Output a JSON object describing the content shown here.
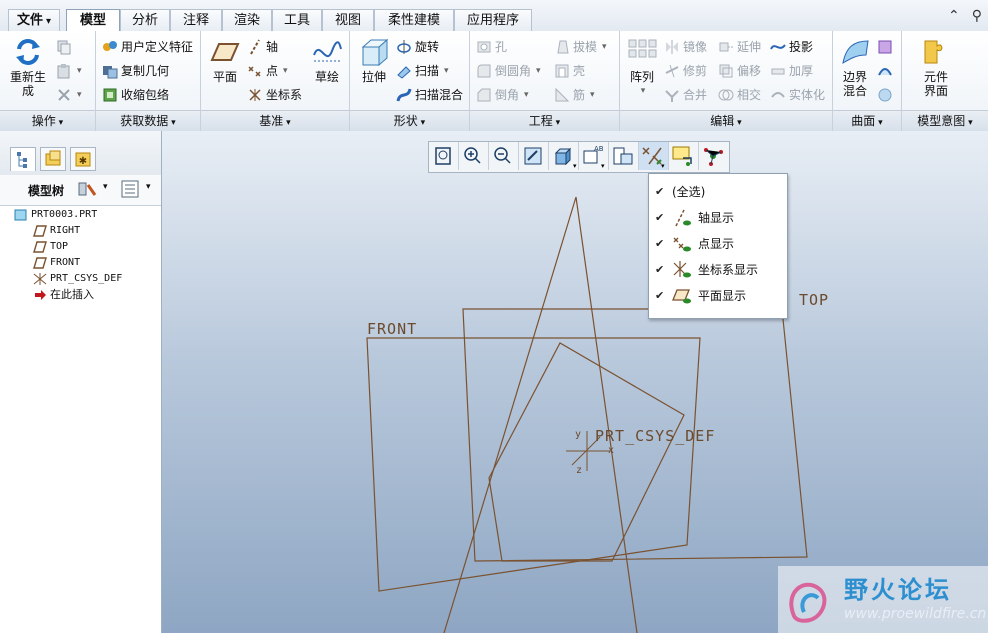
{
  "menu": {
    "tabs": [
      "文件",
      "模型",
      "分析",
      "注释",
      "渲染",
      "工具",
      "视图",
      "柔性建模",
      "应用程序"
    ],
    "active": "模型"
  },
  "ribbon": {
    "groups": {
      "operation": "操作",
      "get_data": "获取数据",
      "datum": "基准",
      "shape": "形状",
      "engineering": "工程",
      "edit": "编辑",
      "surface": "曲面",
      "model_intent": "模型意图"
    },
    "regenerate": "重新生成",
    "user_defined_feature": "用户定义特征",
    "copy_geometry": "复制几何",
    "shrinkwrap": "收缩包络",
    "plane": "平面",
    "axis": "轴",
    "point": "点",
    "csys": "坐标系",
    "sketch": "草绘",
    "extrude": "拉伸",
    "revolve": "旋转",
    "sweep": "扫描",
    "swept_blend": "扫描混合",
    "hole": "孔",
    "round": "倒圆角",
    "chamfer": "倒角",
    "draft": "拔模",
    "shell": "壳",
    "rib": "筋",
    "pattern": "阵列",
    "mirror": "镜像",
    "trim": "修剪",
    "merge": "合并",
    "extend": "延伸",
    "offset": "偏移",
    "intersect": "相交",
    "project": "投影",
    "thicken": "加厚",
    "solidify": "实体化",
    "boundary_blend_1": "边界",
    "boundary_blend_2": "混合",
    "component_interface_1": "元件",
    "component_interface_2": "界面"
  },
  "left_panel": {
    "title": "模型树",
    "tree": [
      "PRT0003.PRT",
      "RIGHT",
      "TOP",
      "FRONT",
      "PRT_CSYS_DEF",
      "在此插入"
    ]
  },
  "viewport": {
    "labels": {
      "front": "FRONT",
      "top": "TOP",
      "csys": "PRT_CSYS_DEF",
      "csys_x": "x",
      "csys_y": "y",
      "csys_z": "z"
    }
  },
  "dropdown": {
    "items": [
      "(全选)",
      "轴显示",
      "点显示",
      "坐标系显示",
      "平面显示"
    ]
  },
  "watermark": {
    "title": "野火论坛",
    "url": "www.proewildfire.cn"
  },
  "colors": {
    "datum_plane": "#7a5230",
    "viewport_top": "#e8eef5",
    "viewport_bottom": "#8ea6c3"
  }
}
